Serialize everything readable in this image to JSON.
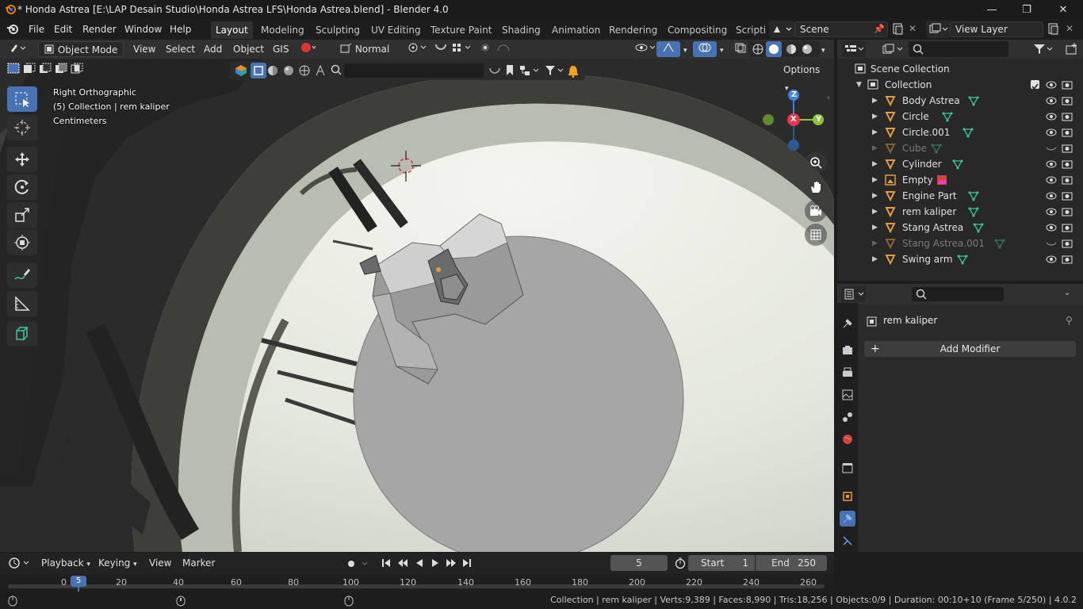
{
  "window": {
    "title": "* Honda Astrea [E:\\LAP Desain Studio\\Honda Astrea LFS\\Honda Astrea.blend] - Blender 4.0"
  },
  "menu": [
    "File",
    "Edit",
    "Render",
    "Window",
    "Help"
  ],
  "workspaces": [
    "Layout",
    "Modeling",
    "Sculpting",
    "UV Editing",
    "Texture Paint",
    "Shading",
    "Animation",
    "Rendering",
    "Compositing",
    "Scripti"
  ],
  "active_workspace": "Layout",
  "scene": "Scene",
  "view_layer": "View Layer",
  "viewport_header": {
    "mode": "Object Mode",
    "items": [
      "View",
      "Select",
      "Add",
      "Object",
      "GIS"
    ],
    "orientation": "Normal",
    "options": "Options"
  },
  "viewport_overlay": {
    "view_name": "Right Orthographic",
    "collection_info": "(5) Collection | rem kaliper",
    "units": "Centimeters"
  },
  "gizmo": {
    "z": "Z",
    "x": "X",
    "y": "Y"
  },
  "outliner": {
    "root": "Scene Collection",
    "collection": "Collection",
    "items": [
      {
        "name": "Body Astrea",
        "dim": false
      },
      {
        "name": "Circle",
        "dim": false
      },
      {
        "name": "Circle.001",
        "dim": false
      },
      {
        "name": "Cube",
        "dim": true
      },
      {
        "name": "Cylinder",
        "dim": false
      },
      {
        "name": "Empty",
        "dim": false
      },
      {
        "name": "Engine Part",
        "dim": false
      },
      {
        "name": "rem kaliper",
        "dim": false
      },
      {
        "name": "Stang Astrea",
        "dim": false
      },
      {
        "name": "Stang Astrea.001",
        "dim": true
      },
      {
        "name": "Swing arm",
        "dim": false
      }
    ]
  },
  "properties": {
    "object_name": "rem kaliper",
    "add_modifier": "Add Modifier"
  },
  "timeline": {
    "menus": [
      "Playback",
      "Keying",
      "View",
      "Marker"
    ],
    "current_frame": "5",
    "start_label": "Start",
    "start": "1",
    "end_label": "End",
    "end": "250",
    "ticks": [
      "0",
      "20",
      "40",
      "60",
      "80",
      "100",
      "120",
      "140",
      "160",
      "180",
      "200",
      "220",
      "240",
      "260"
    ],
    "playhead_label": "5"
  },
  "status": "Collection | rem kaliper | Verts:9,389 | Faces:8,990 | Tris:18,256 | Objects:0/9 | Duration: 00:10+10 (Frame 5/250) | 4.0.2",
  "colors": {
    "accent": "#4772b3",
    "object_orange": "#e39d3c",
    "mesh_green": "#3bc5a0",
    "axis_x": "#e5384f",
    "axis_y": "#8bc43b",
    "axis_z": "#3a85e0"
  }
}
